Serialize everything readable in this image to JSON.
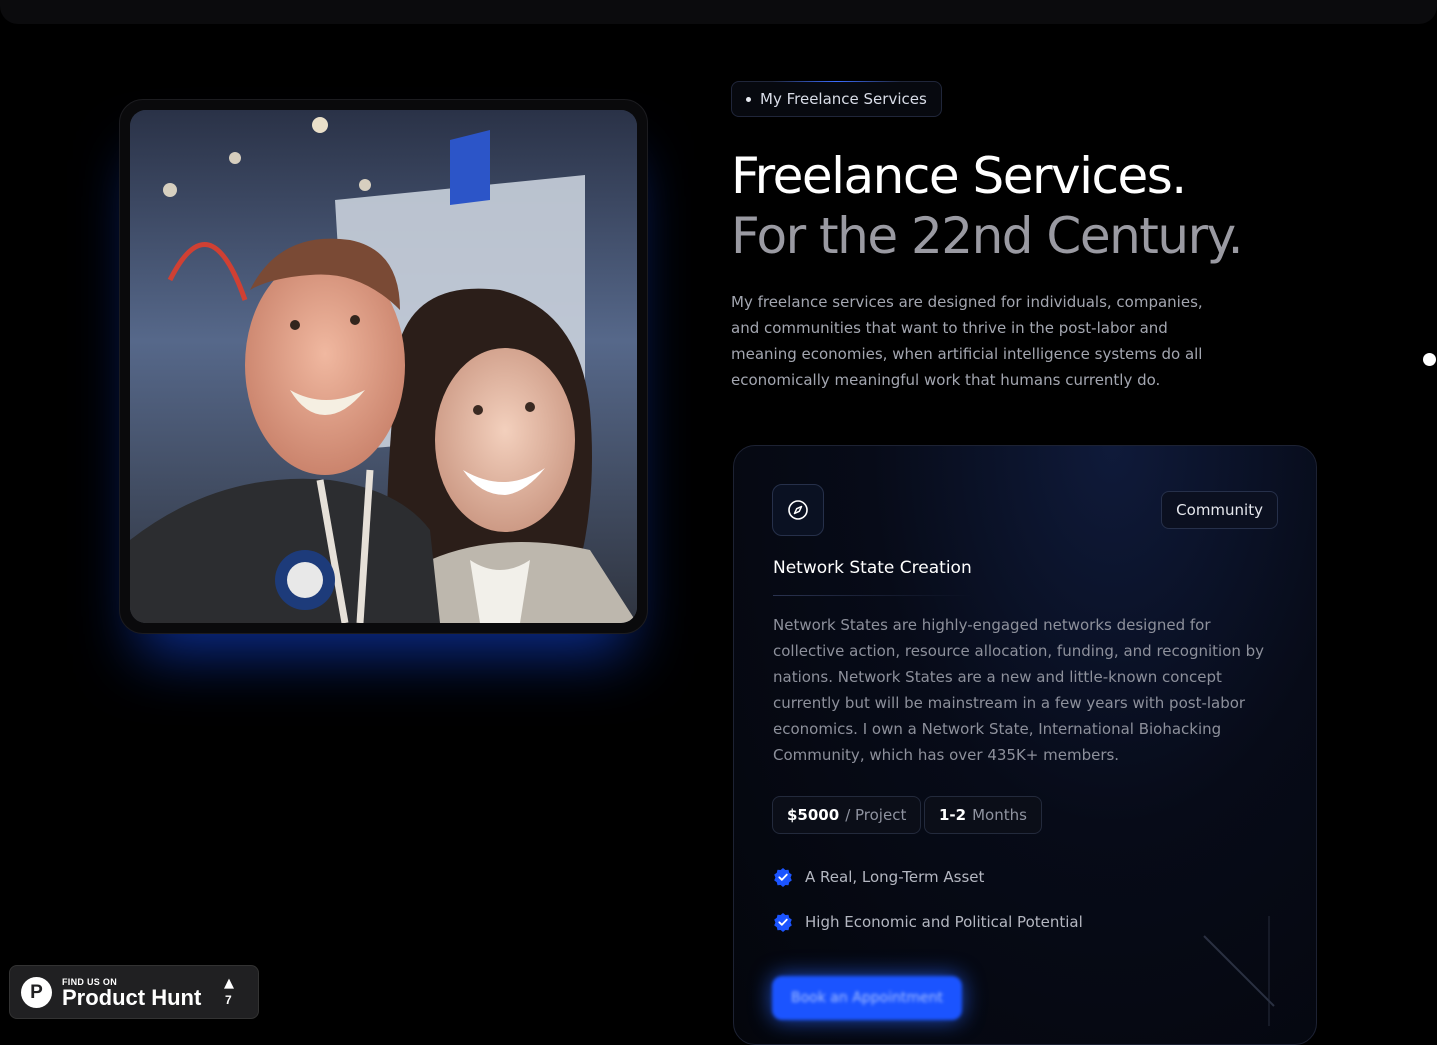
{
  "hero": {
    "badge_label": "My Freelance Services",
    "title_line1": "Freelance Services.",
    "title_line2": "For the 22nd Century.",
    "description": "My freelance services are designed for individuals, companies, and communities that want to thrive in the post-labor and meaning economies, when artificial intelligence systems do all economically meaningful work that humans currently do."
  },
  "service_card": {
    "icon": "compass-icon",
    "tag": "Community",
    "title": "Network State Creation",
    "description": "Network States are highly-engaged networks designed for collective action, resource allocation, funding, and recognition by nations. Network States are a new and little-known concept currently but will be mainstream in a few years with post-labor economics. I own a Network State, International Biohacking Community, which has over 435K+ members.",
    "price_value": "$5000",
    "price_unit": "/ Project",
    "duration_value": "1-2",
    "duration_unit": "Months",
    "features": [
      "A Real, Long-Term Asset",
      "High Economic and Political Potential"
    ],
    "cta_label": "Book an Appointment"
  },
  "product_hunt": {
    "find_label": "FIND US ON",
    "brand": "Product Hunt",
    "logo_letter": "P",
    "upvotes": "7"
  },
  "colors": {
    "accent": "#1b54ff",
    "background": "#000000",
    "muted_text": "#9a9aa2"
  }
}
